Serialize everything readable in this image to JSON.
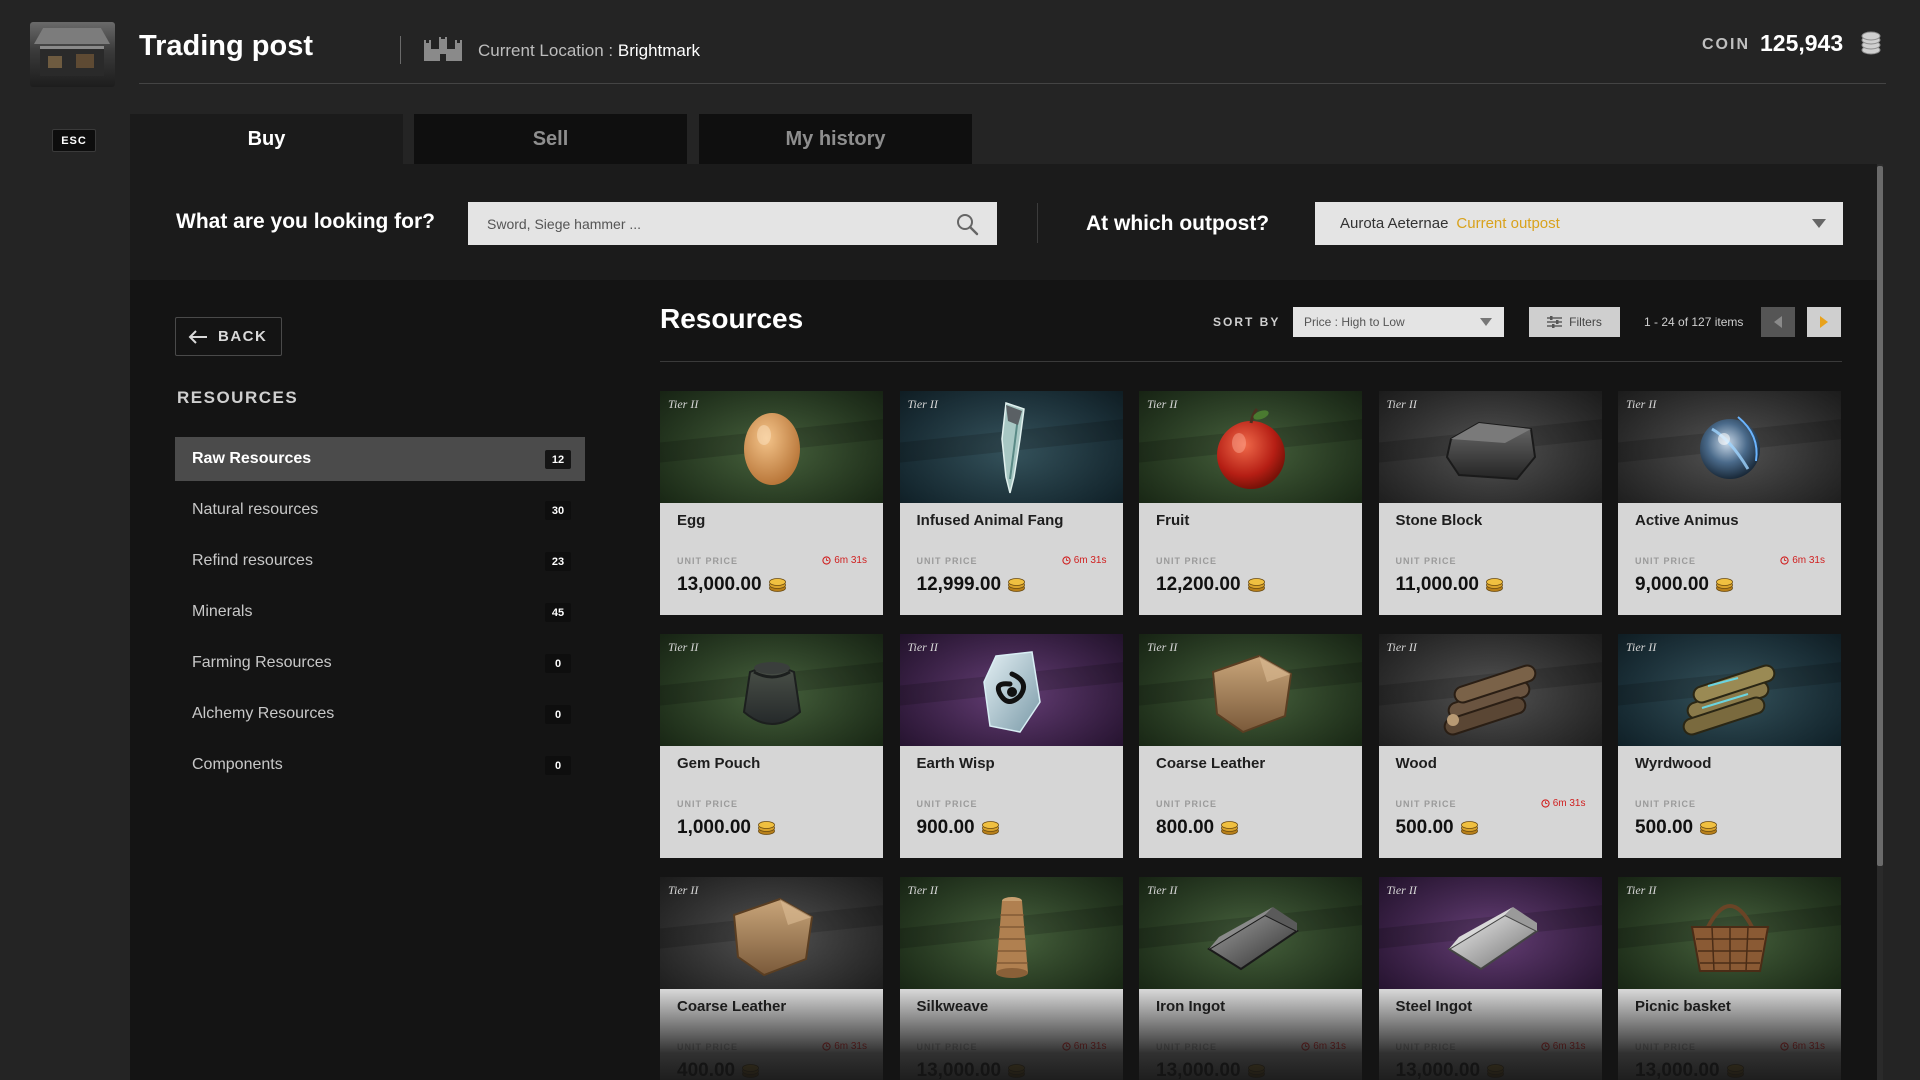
{
  "header": {
    "title": "Trading post",
    "location_label": "Current Location : ",
    "location_value": "Brightmark",
    "coin_label": "COIN",
    "coin_value": "125,943"
  },
  "esc_label": "ESC",
  "tabs": [
    {
      "label": "Buy",
      "active": true
    },
    {
      "label": "Sell",
      "active": false
    },
    {
      "label": "My history",
      "active": false
    }
  ],
  "search": {
    "question": "What are you looking for?",
    "placeholder": "Sword, Siege hammer ...",
    "outpost_question": "At which outpost?",
    "outpost_value": "Aurota Aeternae",
    "outpost_tag": "Current outpost"
  },
  "sidebar": {
    "back_label": "BACK",
    "heading": "RESOURCES",
    "categories": [
      {
        "label": "Raw Resources",
        "count": "12",
        "active": true
      },
      {
        "label": "Natural resources",
        "count": "30",
        "active": false
      },
      {
        "label": "Refind resources",
        "count": "23",
        "active": false
      },
      {
        "label": "Minerals",
        "count": "45",
        "active": false
      },
      {
        "label": "Farming Resources",
        "count": "0",
        "active": false
      },
      {
        "label": "Alchemy Resources",
        "count": "0",
        "active": false
      },
      {
        "label": "Components",
        "count": "0",
        "active": false
      }
    ]
  },
  "content": {
    "title": "Resources",
    "sort_label": "SORT BY",
    "sort_value": "Price : High to Low",
    "filters_label": "Filters",
    "items_count": "1 - 24 of 127 items",
    "unit_price_label": "UNIT PRICE",
    "tier_label": "Tier II"
  },
  "colors": {
    "accent": "#e8a21c",
    "timer": "#d02020",
    "bg_green": "#2e4a26",
    "bg_teal": "#1d3a44",
    "bg_gray": "#3a3a3a",
    "bg_purple": "#4a2658"
  },
  "items": [
    {
      "name": "Egg",
      "price": "13,000.00",
      "timer": "6m 31s",
      "bg": "green",
      "icon": "egg-icon"
    },
    {
      "name": "Infused Animal Fang",
      "price": "12,999.00",
      "timer": "6m 31s",
      "bg": "teal",
      "icon": "fang-icon"
    },
    {
      "name": "Fruit",
      "price": "12,200.00",
      "timer": "",
      "bg": "green",
      "icon": "apple-icon"
    },
    {
      "name": "Stone Block",
      "price": "11,000.00",
      "timer": "",
      "bg": "gray",
      "icon": "stone-block-icon"
    },
    {
      "name": "Active Animus",
      "price": "9,000.00",
      "timer": "6m 31s",
      "bg": "gray",
      "icon": "animus-orb-icon"
    },
    {
      "name": "Gem Pouch",
      "price": "1,000.00",
      "timer": "",
      "bg": "green",
      "icon": "pouch-icon"
    },
    {
      "name": "Earth Wisp",
      "price": "900.00",
      "timer": "",
      "bg": "purple",
      "icon": "wisp-crystal-icon"
    },
    {
      "name": "Coarse Leather",
      "price": "800.00",
      "timer": "",
      "bg": "green",
      "icon": "leather-icon"
    },
    {
      "name": "Wood",
      "price": "500.00",
      "timer": "6m 31s",
      "bg": "gray",
      "icon": "wood-logs-icon"
    },
    {
      "name": "Wyrdwood",
      "price": "500.00",
      "timer": "",
      "bg": "teal",
      "icon": "wyrdwood-logs-icon"
    },
    {
      "name": "Coarse Leather",
      "price": "400.00",
      "timer": "6m 31s",
      "bg": "gray",
      "icon": "leather-icon"
    },
    {
      "name": "Silkweave",
      "price": "13,000.00",
      "timer": "6m 31s",
      "bg": "green",
      "icon": "silk-spool-icon"
    },
    {
      "name": "Iron Ingot",
      "price": "13,000.00",
      "timer": "6m 31s",
      "bg": "green",
      "icon": "iron-ingot-icon"
    },
    {
      "name": "Steel Ingot",
      "price": "13,000.00",
      "timer": "6m 31s",
      "bg": "purple",
      "icon": "steel-ingot-icon"
    },
    {
      "name": "Picnic basket",
      "price": "13,000.00",
      "timer": "6m 31s",
      "bg": "green",
      "icon": "basket-icon"
    }
  ]
}
